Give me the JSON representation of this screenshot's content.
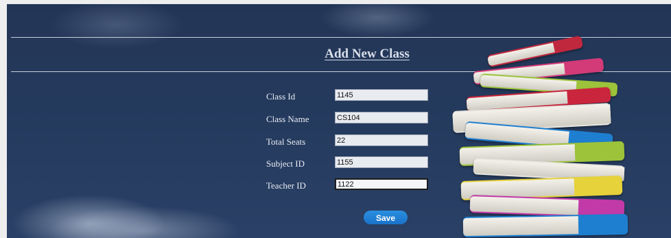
{
  "page": {
    "title": "Add New Class"
  },
  "form": {
    "fields": [
      {
        "label": "Class Id",
        "value": "1145"
      },
      {
        "label": "Class Name",
        "value": "CS104"
      },
      {
        "label": "Total Seats",
        "value": "22"
      },
      {
        "label": "Subject ID",
        "value": "1155"
      },
      {
        "label": "Teacher ID",
        "value": "1122"
      }
    ],
    "focused_field": "Teacher ID",
    "save_label": "Save"
  },
  "colors": {
    "background": "#243a5d",
    "save_button": "#1f7fd4",
    "input_bg": "#e8ebf0"
  },
  "icons": {
    "background_art": "book-stack-illustration"
  }
}
